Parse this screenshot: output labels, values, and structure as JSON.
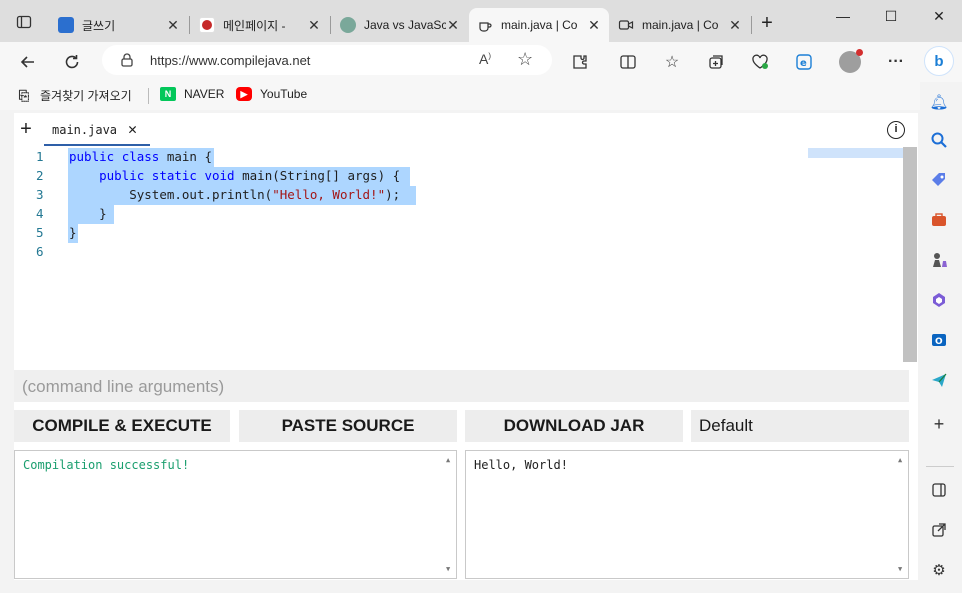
{
  "browser": {
    "tabs": [
      {
        "title": "글쓰기",
        "favicon": "globe-blue-icon",
        "active": false
      },
      {
        "title": "메인페이지 - ",
        "favicon": "red-logo-icon",
        "active": false
      },
      {
        "title": "Java vs JavaSc",
        "favicon": "chatgpt-icon",
        "active": false
      },
      {
        "title": "main.java | Co",
        "favicon": "coffee-icon",
        "active": true
      },
      {
        "title": "main.java | Co",
        "favicon": "video-icon",
        "active": false
      }
    ],
    "new_tab": "+",
    "controls": {
      "minimize": "—",
      "maximize": "☐",
      "close": "✕"
    },
    "address": {
      "url": "https://www.compilejava.net"
    },
    "favorites": [
      {
        "label": "즐겨찾기 가져오기",
        "icon": "import-icon"
      },
      {
        "label": "NAVER",
        "icon": "naver-icon"
      },
      {
        "label": "YouTube",
        "icon": "youtube-icon"
      }
    ]
  },
  "editor": {
    "file_tab": "main.java",
    "line_numbers": [
      "1",
      "2",
      "3",
      "4",
      "5",
      "6"
    ],
    "code": {
      "line1": {
        "kw1": "public",
        "kw2": "class",
        "rest": " main {"
      },
      "line2": {
        "kw1": "public",
        "kw2": "static",
        "kw3": "void",
        "rest": " main(String[] args) {"
      },
      "line3": {
        "pre": "System.out.println(",
        "str": "\"Hello, World!\"",
        "post": ");"
      },
      "line4": "}",
      "line5": "}"
    }
  },
  "controls": {
    "args_placeholder": "(command line arguments)",
    "compile_label": "COMPILE & EXECUTE",
    "paste_label": "PASTE SOURCE",
    "download_label": "DOWNLOAD JAR",
    "select_value": "Default"
  },
  "output": {
    "compile_msg": "Compilation successful!",
    "program_output": "Hello, World!"
  },
  "colors": {
    "keyword": "#0000ff",
    "string": "#a31515",
    "success": "#1a9e6e",
    "selection": "#add6ff"
  }
}
